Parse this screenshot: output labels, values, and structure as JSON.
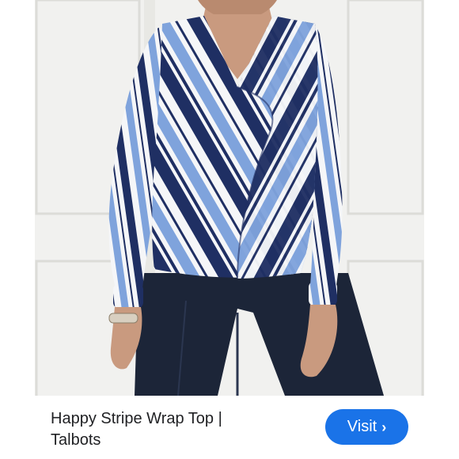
{
  "result": {
    "title_line1": "Happy Stripe Wrap Top |",
    "title_line2": "Talbots",
    "visit_label": "Visit",
    "visit_icon": "chevron-right-icon"
  },
  "colors": {
    "navy": "#1f2f63",
    "periwinkle": "#7fa3dc",
    "white": "#f5f6f8",
    "denim": "#1c2538",
    "skin": "#c99a7f",
    "wall": "#f1f1ef",
    "button": "#1a73e8"
  }
}
